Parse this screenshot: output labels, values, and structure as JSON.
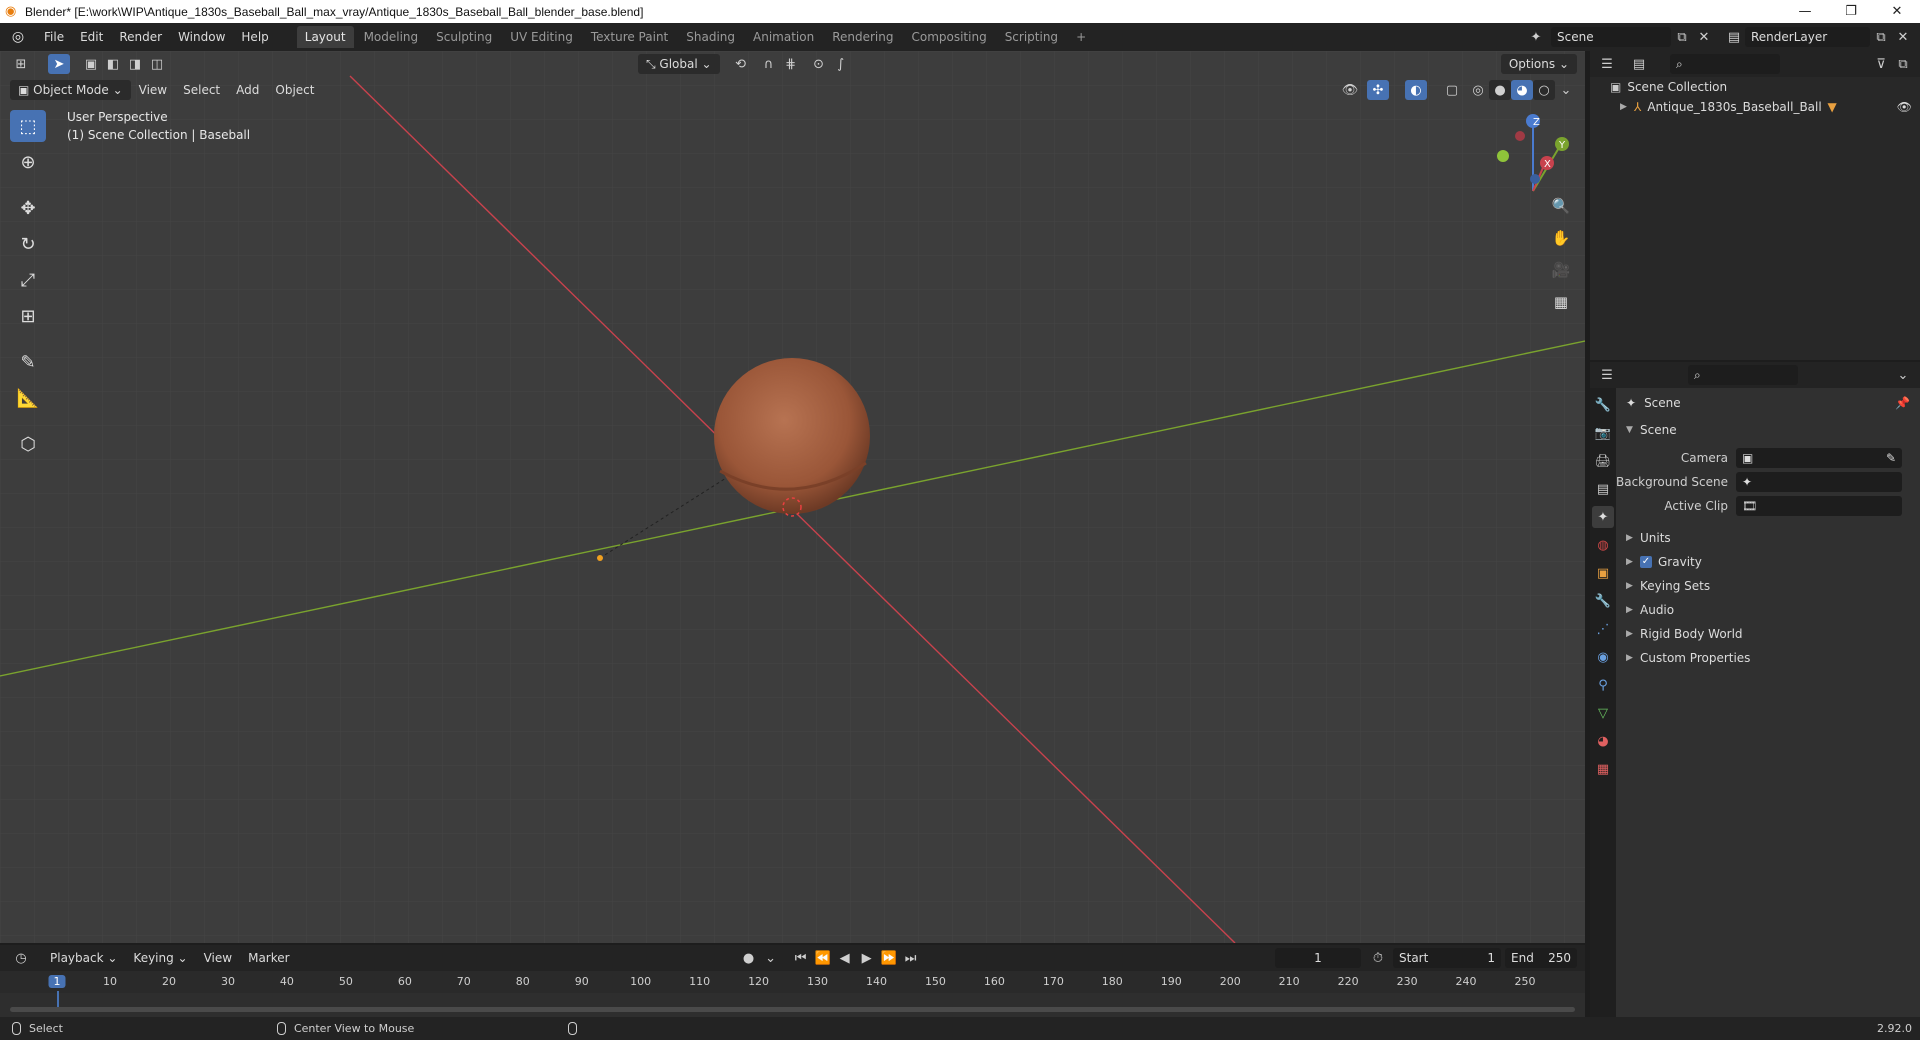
{
  "window": {
    "title": "Blender* [E:\\work\\WIP\\Antique_1830s_Baseball_Ball_max_vray/Antique_1830s_Baseball_Ball_blender_base.blend]",
    "minimize": "—",
    "maximize": "❐",
    "close": "✕"
  },
  "menu": [
    "File",
    "Edit",
    "Render",
    "Window",
    "Help"
  ],
  "workspaces": [
    "Layout",
    "Modeling",
    "Sculpting",
    "UV Editing",
    "Texture Paint",
    "Shading",
    "Animation",
    "Rendering",
    "Compositing",
    "Scripting"
  ],
  "workspace_add": "+",
  "scene_field": "Scene",
  "renderlayer_field": "RenderLayer",
  "viewport": {
    "mode": "Object Mode",
    "menus": [
      "View",
      "Select",
      "Add",
      "Object"
    ],
    "orientation": "Global",
    "options": "Options",
    "info_line1": "User Perspective",
    "info_line2": "(1) Scene Collection | Baseball",
    "gizmo": {
      "x": "X",
      "y": "Y",
      "z": "Z"
    }
  },
  "outliner": {
    "search_placeholder": "",
    "root": "Scene Collection",
    "items": [
      "Antique_1830s_Baseball_Ball"
    ]
  },
  "properties": {
    "context": "Scene",
    "panel": "Scene",
    "fields": [
      {
        "label": "Camera",
        "value": ""
      },
      {
        "label": "Background Scene",
        "value": ""
      },
      {
        "label": "Active Clip",
        "value": ""
      }
    ],
    "subpanels": [
      "Units",
      "Gravity",
      "Keying Sets",
      "Audio",
      "Rigid Body World",
      "Custom Properties"
    ],
    "gravity_checked": true
  },
  "timeline": {
    "menus": [
      "Playback",
      "Keying",
      "View",
      "Marker"
    ],
    "current_frame": "1",
    "start_label": "Start",
    "start": "1",
    "end_label": "End",
    "end": "250",
    "ticks": [
      "1",
      "10",
      "20",
      "30",
      "40",
      "50",
      "60",
      "70",
      "80",
      "90",
      "100",
      "110",
      "120",
      "130",
      "140",
      "150",
      "160",
      "170",
      "180",
      "190",
      "200",
      "210",
      "220",
      "230",
      "240",
      "250"
    ]
  },
  "status": {
    "left": "Select",
    "middle": "Center View to Mouse",
    "version": "2.92.0"
  },
  "colors": {
    "accent": "#4772b3",
    "x_axis": "#c8424d",
    "y_axis": "#7aa32e",
    "ball": "#a35a3b"
  }
}
